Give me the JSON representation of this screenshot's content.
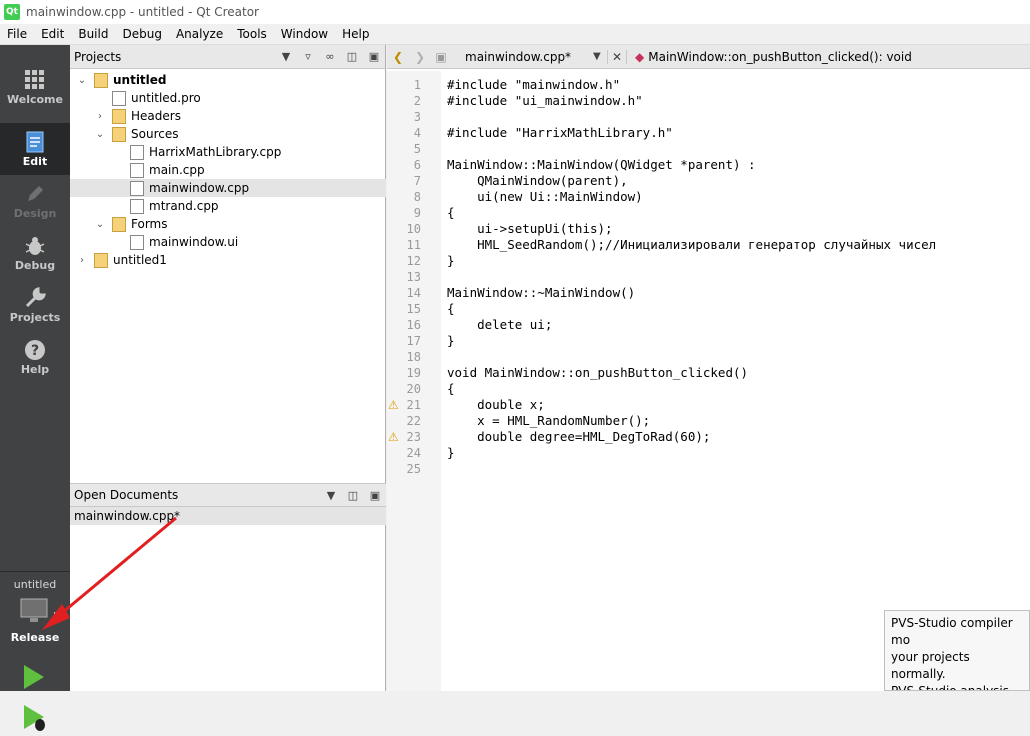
{
  "window": {
    "title": "mainwindow.cpp - untitled - Qt Creator",
    "logo_text": "Qt"
  },
  "menu": [
    "File",
    "Edit",
    "Build",
    "Debug",
    "Analyze",
    "Tools",
    "Window",
    "Help"
  ],
  "modes": [
    {
      "label": "Welcome",
      "icon": "grid-icon"
    },
    {
      "label": "Edit",
      "icon": "document-icon"
    },
    {
      "label": "Design",
      "icon": "pencil-icon"
    },
    {
      "label": "Debug",
      "icon": "bug-icon"
    },
    {
      "label": "Projects",
      "icon": "wrench-icon"
    },
    {
      "label": "Help",
      "icon": "question-icon"
    }
  ],
  "run": {
    "project": "untitled",
    "config": "Release"
  },
  "projects": {
    "title": "Projects",
    "items": [
      {
        "label": "untitled",
        "depth": 0,
        "arrow": "v",
        "bold": true,
        "icon": "folder"
      },
      {
        "label": "untitled.pro",
        "depth": 1,
        "arrow": "",
        "icon": "file"
      },
      {
        "label": "Headers",
        "depth": 1,
        "arrow": ">",
        "icon": "folder"
      },
      {
        "label": "Sources",
        "depth": 1,
        "arrow": "v",
        "icon": "folder"
      },
      {
        "label": "HarrixMathLibrary.cpp",
        "depth": 2,
        "arrow": "",
        "icon": "file"
      },
      {
        "label": "main.cpp",
        "depth": 2,
        "arrow": "",
        "icon": "file"
      },
      {
        "label": "mainwindow.cpp",
        "depth": 2,
        "arrow": "",
        "icon": "file",
        "selected": true
      },
      {
        "label": "mtrand.cpp",
        "depth": 2,
        "arrow": "",
        "icon": "file"
      },
      {
        "label": "Forms",
        "depth": 1,
        "arrow": "v",
        "icon": "folder"
      },
      {
        "label": "mainwindow.ui",
        "depth": 2,
        "arrow": "",
        "icon": "file"
      },
      {
        "label": "untitled1",
        "depth": 0,
        "arrow": ">",
        "icon": "folder"
      }
    ]
  },
  "open_docs": {
    "title": "Open Documents",
    "items": [
      "mainwindow.cpp*"
    ]
  },
  "editor": {
    "file_tab": "mainwindow.cpp*",
    "symbol": "MainWindow::on_pushButton_clicked(): void",
    "line_numbers": [
      "1",
      "2",
      "3",
      "4",
      "5",
      "6",
      "7",
      "8",
      "9",
      "10",
      "11",
      "12",
      "13",
      "14",
      "15",
      "16",
      "17",
      "18",
      "19",
      "20",
      "21",
      "22",
      "23",
      "24",
      "25"
    ],
    "warning_lines": [
      21,
      23
    ],
    "lines": [
      "#include \"mainwindow.h\"",
      "#include \"ui_mainwindow.h\"",
      "",
      "#include \"HarrixMathLibrary.h\"",
      "",
      "MainWindow::MainWindow(QWidget *parent) :",
      "    QMainWindow(parent),",
      "    ui(new Ui::MainWindow)",
      "{",
      "    ui->setupUi(this);",
      "    HML_SeedRandom();//Инициализировали генератор случайных чисел",
      "}",
      "",
      "MainWindow::~MainWindow()",
      "{",
      "    delete ui;",
      "}",
      "",
      "void MainWindow::on_pushButton_clicked()",
      "{",
      "    double x;",
      "    x = HML_RandomNumber();",
      "    double degree=HML_DegToRad(60);",
      "}",
      ""
    ]
  },
  "toast": {
    "lines": [
      "PVS-Studio compiler mo",
      "your projects normally.",
      "PVS-Studio analysis."
    ]
  },
  "colors": {
    "modebar": "#404244",
    "accent_run": "#5fbf3f",
    "arrow": "#e02020"
  }
}
